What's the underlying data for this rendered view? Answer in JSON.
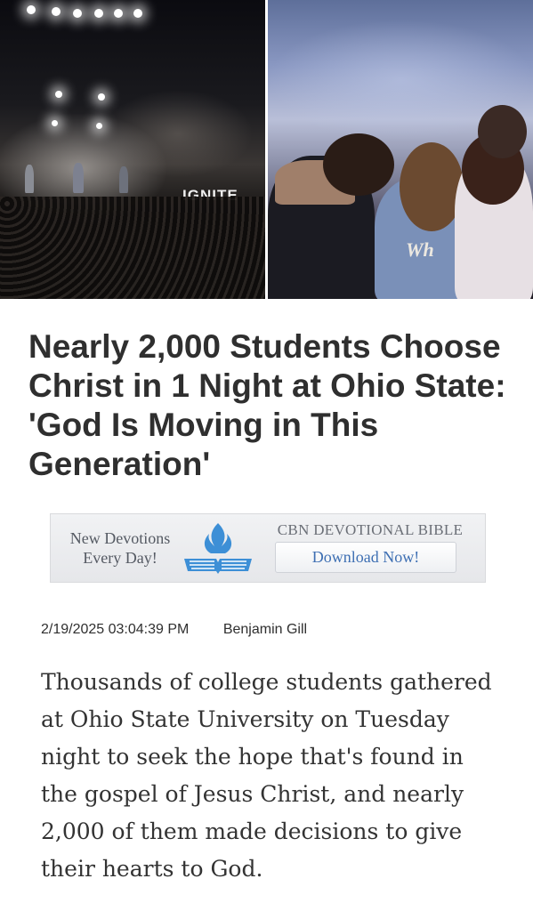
{
  "hero": {
    "left_image": {
      "description_icon": "worship-concert-photo",
      "stage_sign": "IGNITE"
    },
    "right_image": {
      "description_icon": "students-praying-photo",
      "jacket_text": "Wh"
    }
  },
  "article": {
    "headline": "Nearly 2,000 Students Choose Christ in 1 Night at Ohio State: 'God Is Moving in This Generation'",
    "date": "2/19/2025 03:04:39 PM",
    "author": "Benjamin Gill",
    "body": "Thousands of college students gathered at Ohio State University on Tuesday night to seek the hope that's found in the gospel of Jesus Christ, and nearly 2,000 of them made decisions to give their hearts to God."
  },
  "ad": {
    "tagline_line1": "New Devotions",
    "tagline_line2": "Every Day!",
    "title": "CBN DEVOTIONAL BIBLE",
    "button_label": "Download Now!",
    "logo_icon": "flame-bible-icon",
    "colors": {
      "logo_blue": "#3d8fd6",
      "button_text": "#3e6fb3"
    }
  }
}
